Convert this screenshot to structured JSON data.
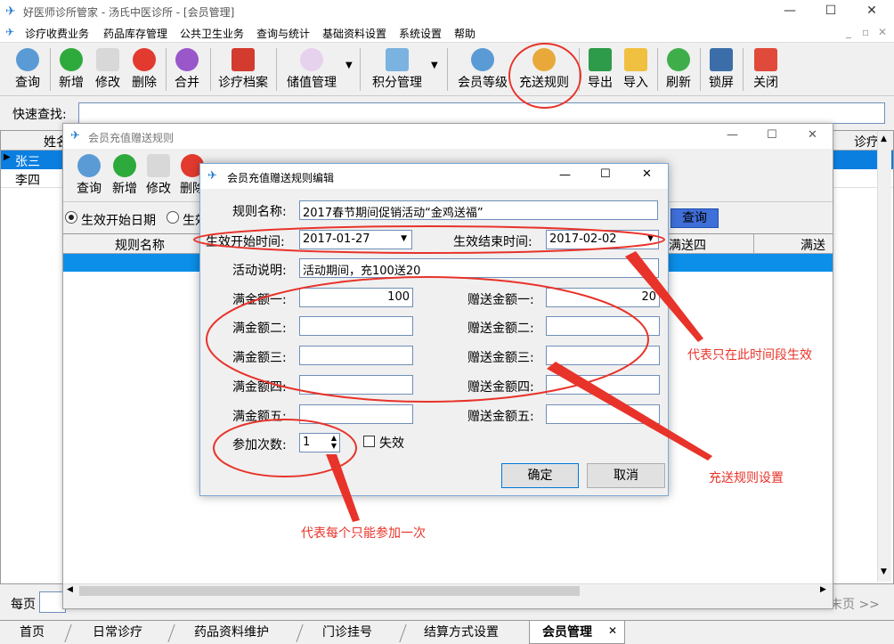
{
  "app": {
    "title": "好医师诊所管家 - 汤氏中医诊所 - [会员管理]"
  },
  "menu": [
    "诊疗收费业务",
    "药品库存管理",
    "公共卫生业务",
    "查询与统计",
    "基础资料设置",
    "系统设置",
    "帮助"
  ],
  "toolbar": {
    "items": [
      "查询",
      "新增",
      "修改",
      "删除",
      "合并",
      "诊疗档案",
      "储值管理",
      "积分管理",
      "会员等级",
      "充送规则",
      "导出",
      "导入",
      "刷新",
      "锁屏",
      "关闭"
    ]
  },
  "quick_search": {
    "label": "快速查找:",
    "value": ""
  },
  "grid": {
    "col_name": "姓名",
    "col_visit": "诊疗",
    "rows": [
      "张三",
      "李四"
    ]
  },
  "paging": {
    "label": "每页",
    "end": "末页 >>"
  },
  "dialog1": {
    "title": "会员充值赠送规则",
    "toolbar": [
      "查询",
      "新增",
      "修改",
      "删除"
    ],
    "radio1": "生效开始日期",
    "radio2": "生效",
    "query_btn": "查询",
    "col_rule": "规则名称",
    "col_m4": "满送四",
    "col_m5": "满送五"
  },
  "dialog2": {
    "title": "会员充值赠送规则编辑",
    "rule_name_label": "规则名称:",
    "rule_name": "2017春节期间促销活动“金鸡送福”",
    "start_label": "生效开始时间:",
    "start": "2017-01-27",
    "end_label": "生效结束时间:",
    "end": "2017-02-02",
    "desc_label": "活动说明:",
    "desc": "活动期间，充100送20",
    "full": [
      {
        "label": "满金额一:",
        "value": "100"
      },
      {
        "label": "满金额二:",
        "value": ""
      },
      {
        "label": "满金额三:",
        "value": ""
      },
      {
        "label": "满金额四:",
        "value": ""
      },
      {
        "label": "满金额五:",
        "value": ""
      }
    ],
    "gift": [
      {
        "label": "赠送金额一:",
        "value": "20"
      },
      {
        "label": "赠送金额二:",
        "value": ""
      },
      {
        "label": "赠送金额三:",
        "value": ""
      },
      {
        "label": "赠送金额四:",
        "value": ""
      },
      {
        "label": "赠送金额五:",
        "value": ""
      }
    ],
    "times_label": "参加次数:",
    "times": "1",
    "invalid_label": "失效",
    "ok": "确定",
    "cancel": "取消"
  },
  "annotations": {
    "a1": "代表只在此时间段生效",
    "a2": "充送规则设置",
    "a3": "代表每个只能参加一次"
  },
  "tabs": [
    "首页",
    "日常诊疗",
    "药品资料维护",
    "门诊挂号",
    "结算方式设置",
    "会员管理"
  ]
}
